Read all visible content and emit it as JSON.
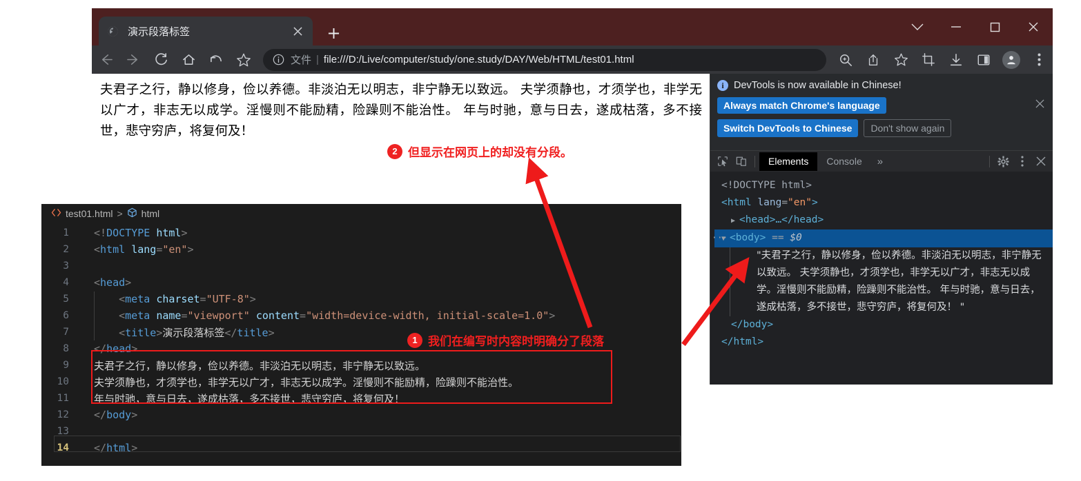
{
  "browser": {
    "tab": {
      "title": "演示段落标签",
      "favicon_icon": "globe-icon",
      "close_icon": "close-icon"
    },
    "new_tab_label": "+",
    "window_controls": [
      {
        "name": "minimize-to-tray-button",
        "glyph": "chevron-down-icon"
      },
      {
        "name": "minimize-button",
        "glyph": "minimize-icon"
      },
      {
        "name": "maximize-button",
        "glyph": "maximize-icon"
      },
      {
        "name": "close-window-button",
        "glyph": "close-icon"
      }
    ],
    "toolbar": {
      "back_icon": "back-arrow-icon",
      "forward_icon": "forward-arrow-icon",
      "reload_icon": "reload-icon",
      "home_icon": "home-icon",
      "undo_icon": "undo-icon",
      "bookmark_star_icon": "star-icon",
      "right_icons": [
        "zoom-in-icon",
        "share-icon",
        "star-icon",
        "screenshot-crop-icon",
        "download-icon",
        "side-panel-icon",
        "profile-avatar-icon",
        "chrome-menu-icon"
      ]
    },
    "omnibox": {
      "info_icon": "info-circle-icon",
      "scheme_label": "文件",
      "separator": "|",
      "url": "file:///D:/Live/computer/study/one.study/DAY/Web/HTML/test01.html"
    }
  },
  "page": {
    "body_text": "夫君子之行，静以修身，俭以养德。非淡泊无以明志，非宁静无以致远。 夫学须静也，才须学也，非学无以广才，非志无以成学。淫慢则不能励精，险躁则不能治性。 年与时驰，意与日去，遂成枯落，多不接世，悲守穷庐，将复何及！"
  },
  "devtools": {
    "notice": {
      "icon": "info-circle-icon",
      "message": "DevTools is now available in Chinese!",
      "primary_button": "Always match Chrome's language",
      "secondary_button": "Switch DevTools to Chinese",
      "tertiary_button": "Don't show again",
      "close_icon": "close-icon"
    },
    "toolbar": {
      "inspect_icon": "inspect-cursor-icon",
      "device_toggle_icon": "device-toolbar-icon",
      "tabs": [
        {
          "label": "Elements",
          "active": true
        },
        {
          "label": "Console",
          "active": false
        }
      ],
      "more_tabs_label": "»",
      "settings_icon": "gear-icon",
      "overflow_icon": "vertical-dots-icon",
      "close_icon": "close-icon"
    },
    "dom": {
      "doctype": "<!DOCTYPE html>",
      "html_open_tag": "<html",
      "html_attr_name": "lang",
      "html_attr_value": "\"en\"",
      "html_open_close": ">",
      "head_collapsed": "<head>…</head>",
      "body_open": "<body>",
      "body_eq": "==",
      "body_selected_var": "$0",
      "text_node": "\"夫君子之行，静以修身，俭以养德。非淡泊无以明志，非宁静无以致远。 夫学须静也，才须学也，非学无以广才，非志无以成学。淫慢则不能励精，险躁则不能治性。 年与时驰，意与日去，遂成枯落，多不接世，悲守穷庐，将复何及！ \"",
      "body_close": "</body>",
      "html_close": "</html>"
    }
  },
  "editor": {
    "breadcrumb": {
      "file_icon": "code-brackets-icon",
      "file_name": "test01.html",
      "separator": ">",
      "symbol_icon": "cube-symbol-icon",
      "symbol_name": "html"
    },
    "active_line": 14,
    "lines": [
      {
        "n": "1",
        "html": "<span class=\"k-punc\">&lt;!</span><span class=\"k-doct\">DOCTYPE</span> <span class=\"k-doctname\">html</span><span class=\"k-punc\">&gt;</span>"
      },
      {
        "n": "2",
        "html": "<span class=\"k-punc\">&lt;</span><span class=\"k-tag\">html</span> <span class=\"k-attr\">lang</span><span class=\"k-punc\">=</span><span class=\"k-val\">\"en\"</span><span class=\"k-punc\">&gt;</span>"
      },
      {
        "n": "3",
        "html": ""
      },
      {
        "n": "4",
        "html": "<span class=\"k-punc\">&lt;</span><span class=\"k-tag\">head</span><span class=\"k-punc\">&gt;</span>"
      },
      {
        "n": "5",
        "html": "    <span class=\"k-punc\">&lt;</span><span class=\"k-tag\">meta</span> <span class=\"k-attr\">charset</span><span class=\"k-punc\">=</span><span class=\"k-val\">\"UTF-8\"</span><span class=\"k-punc\">&gt;</span>",
        "guide": true
      },
      {
        "n": "6",
        "html": "    <span class=\"k-punc\">&lt;</span><span class=\"k-tag\">meta</span> <span class=\"k-attr\">name</span><span class=\"k-punc\">=</span><span class=\"k-val\">\"viewport\"</span> <span class=\"k-attr\">content</span><span class=\"k-punc\">=</span><span class=\"k-val\">\"width=device-width, initial-scale=1.0\"</span><span class=\"k-punc\">&gt;</span>",
        "guide": true
      },
      {
        "n": "7",
        "html": "    <span class=\"k-punc\">&lt;</span><span class=\"k-tag\">title</span><span class=\"k-punc\">&gt;</span><span class=\"k-text cn-zh\">演示段落标签</span><span class=\"k-punc\">&lt;/</span><span class=\"k-tag\">title</span><span class=\"k-punc\">&gt;</span>",
        "guide": true
      },
      {
        "n": "8",
        "html": "<span class=\"k-punc\">&lt;/</span><span class=\"k-tag\">head</span><span class=\"k-punc\">&gt;</span>"
      },
      {
        "n": "9",
        "html": "<span class=\"k-text cn-zh\">夫君子之行，静以修身，俭以养德。非淡泊无以明志，非宁静无以致远。</span>"
      },
      {
        "n": "10",
        "html": "<span class=\"k-text cn-zh\">夫学须静也，才须学也，非学无以广才，非志无以成学。淫慢则不能励精，险躁则不能治性。</span>"
      },
      {
        "n": "11",
        "html": "<span class=\"k-text cn-zh\">年与时驰，意与日去，遂成枯落，多不接世，悲守穷庐，将复何及！</span>"
      },
      {
        "n": "12",
        "html": "<span class=\"k-punc\">&lt;/</span><span class=\"k-tag\">body</span><span class=\"k-punc\">&gt;</span>"
      },
      {
        "n": "13",
        "html": ""
      },
      {
        "n": "14",
        "html": "<span class=\"k-punc\">&lt;/</span><span class=\"k-tag\">html</span><span class=\"k-punc\">&gt;</span>"
      }
    ]
  },
  "annotations": [
    {
      "number": "1",
      "text": "我们在编写时内容时明确分了段落"
    },
    {
      "number": "2",
      "text": "但显示在网页上的却没有分段。"
    }
  ],
  "colors": {
    "titlebar": "#4d2020",
    "toolbar": "#35363a",
    "omnibox": "#202124",
    "devtools_bg": "#202124",
    "devtools_selected_row": "#0b5394",
    "accent_red": "#ee2222",
    "devtools_button_blue": "#1a73c8",
    "editor_bg": "#1c1c1c"
  }
}
